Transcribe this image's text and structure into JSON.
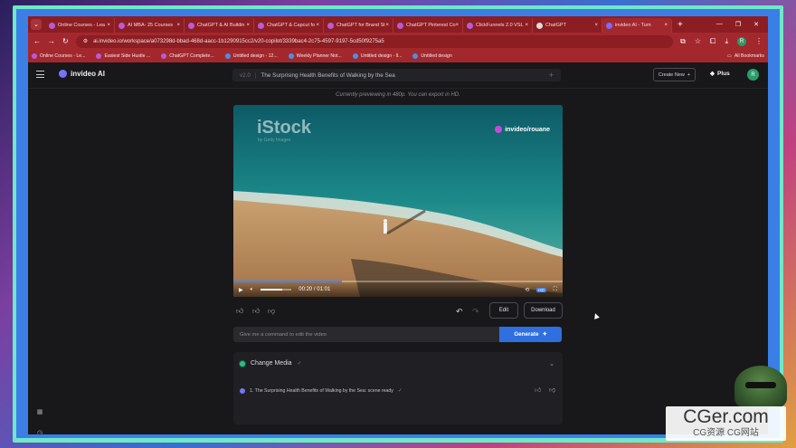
{
  "browser": {
    "tabs": [
      {
        "label": "Online Courses - Lea"
      },
      {
        "label": "AI MBA- 25 Courses"
      },
      {
        "label": "ChatGPT & AI Buildin"
      },
      {
        "label": "ChatGPT & Capcut fo"
      },
      {
        "label": "ChatGPT for Brand St"
      },
      {
        "label": "ChatGPT Pinterest Co"
      },
      {
        "label": "ClickFunnels 2.0 VSL"
      },
      {
        "label": "ChatGPT"
      },
      {
        "label": "invideo AI - Turn"
      }
    ],
    "active_tab_index": 8,
    "url": "ai.invideo.io/workspace/a073298d-bbad-468d-aacc-1b1290915cc2/v20-copilot/3339bac4-2c75-4597-9197-5cd50f9275a5",
    "profile_initial": "R",
    "bookmarks": [
      {
        "label": "Online Courses - Le..."
      },
      {
        "label": "Easiest Side Hustle ..."
      },
      {
        "label": "ChatGPT Complete..."
      },
      {
        "label": "Untitled design - 12..."
      },
      {
        "label": "Weekly Planner Not..."
      },
      {
        "label": "Untitled design - ll..."
      },
      {
        "label": "Untitled design"
      }
    ],
    "all_bookmarks": "All Bookmarks"
  },
  "app": {
    "brand": "invideo AI",
    "version": "v2.0",
    "video_title": "The Surprising Health Benefits of Walking by the Sea",
    "create_new": "Create New",
    "plan": "Plus",
    "avatar_initial": "R",
    "preview_note": "Currently previewing in 480p. You can export in HD."
  },
  "player": {
    "istock": "iStock",
    "istock_sub": "by Getty Images",
    "watermark": "invideo/rouane",
    "current_time": "00:20",
    "duration": "01:01",
    "progress": 0.33,
    "volume": 0.7,
    "quality_badge": "HD"
  },
  "actions": {
    "edit": "Edit",
    "download": "Download"
  },
  "command": {
    "placeholder": "Give me a command to edit the video",
    "generate": "Generate"
  },
  "panel": {
    "title": "Change Media",
    "item": "1. The Surprising Health Benefits of Walking by the Sea: scene ready"
  },
  "overlay": {
    "site": "CGer.com",
    "site_sub": "CG资源 CG网站"
  }
}
